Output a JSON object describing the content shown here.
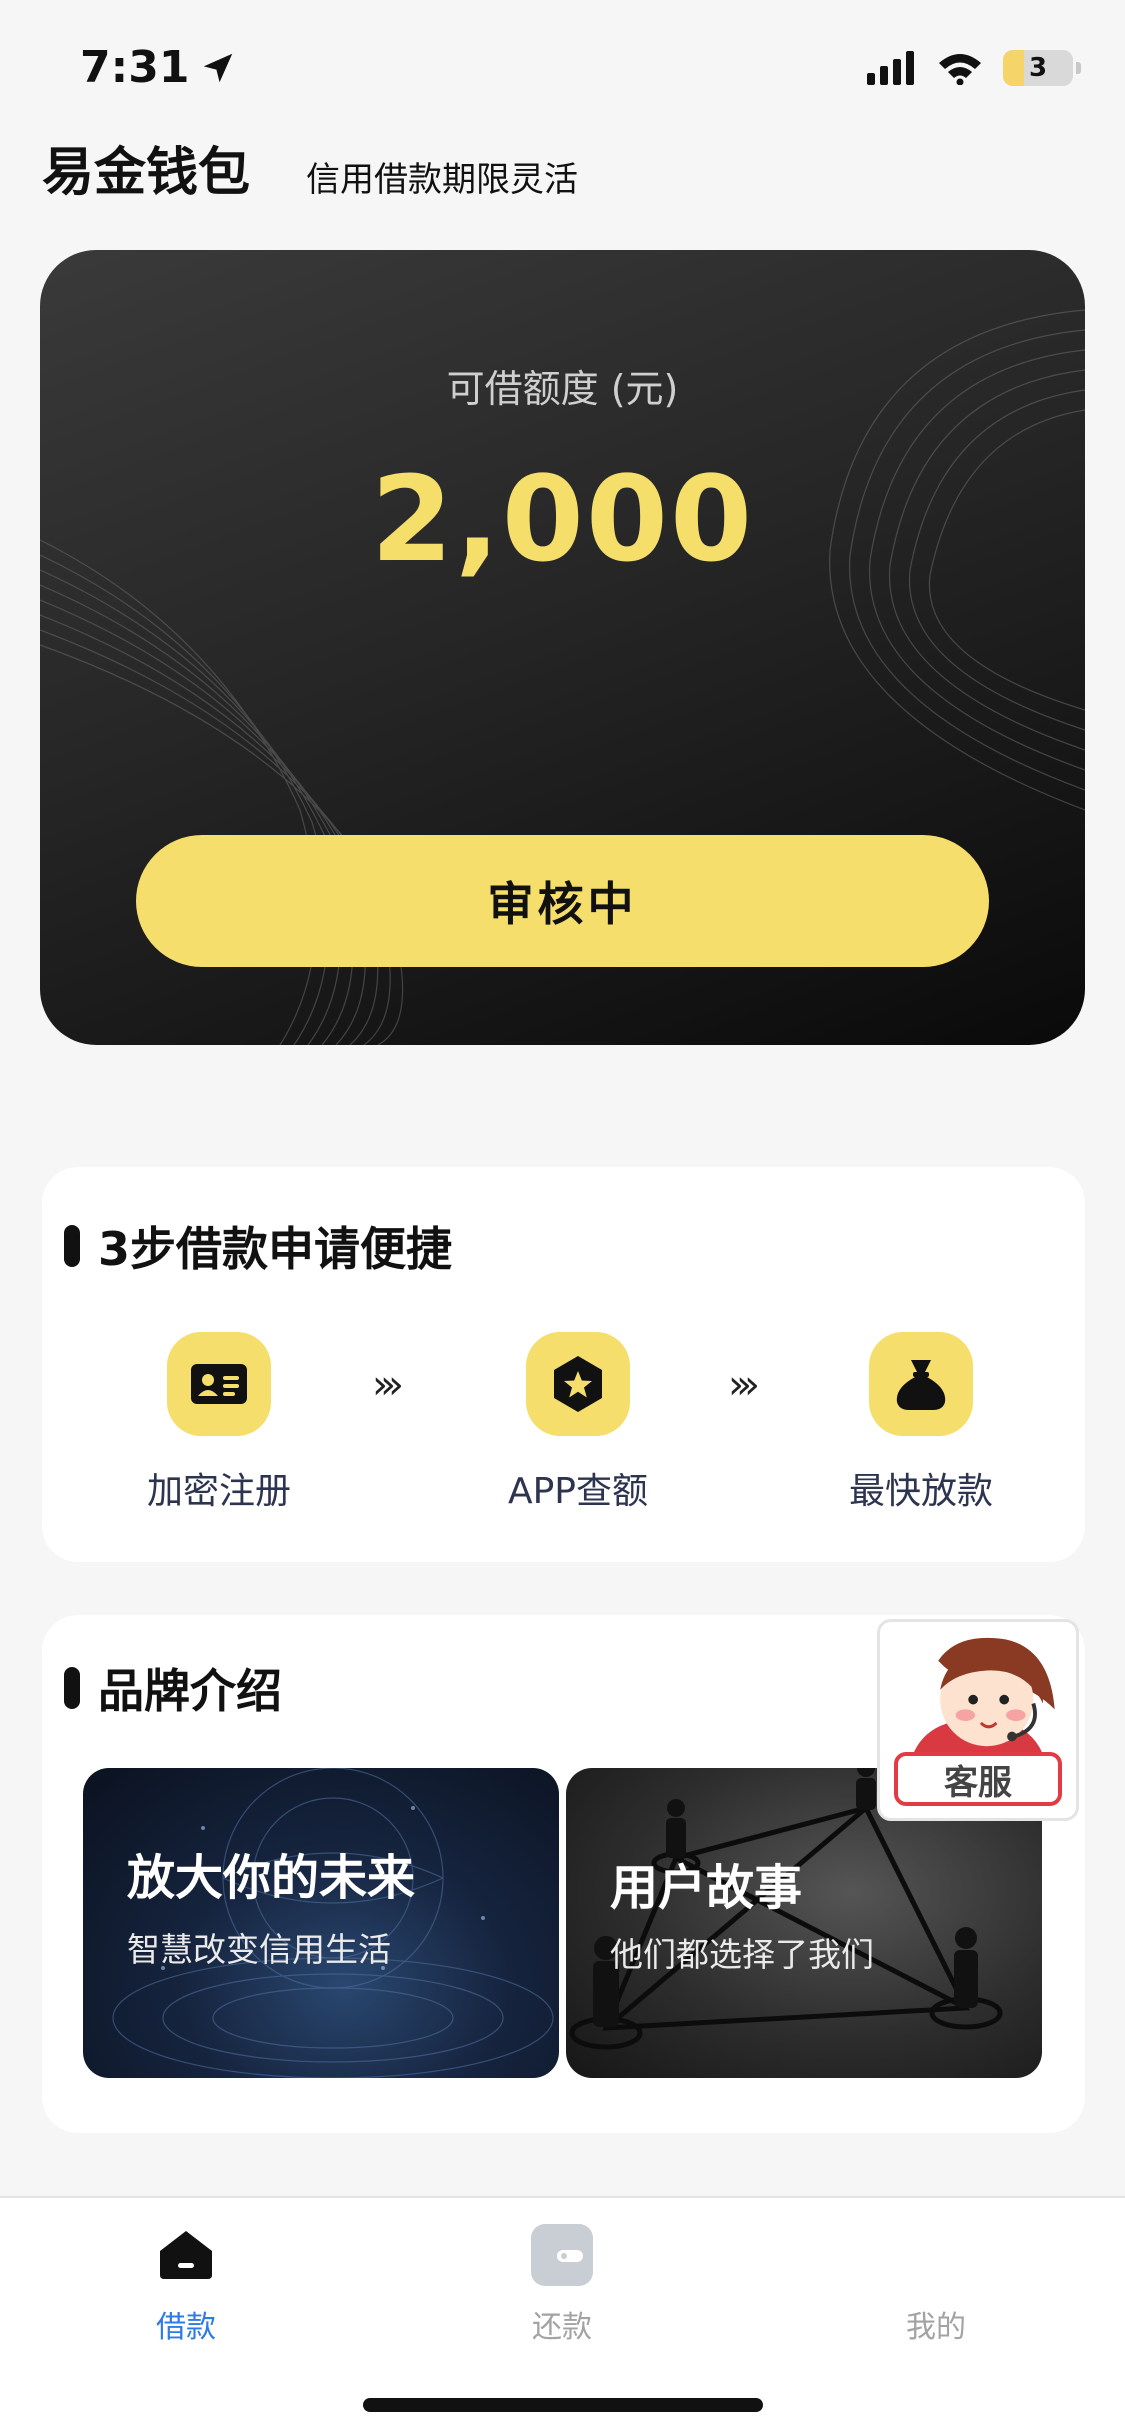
{
  "status_bar": {
    "time": "7:31",
    "battery_level": "3"
  },
  "header": {
    "app_title": "易金钱包",
    "slogan": "信用借款期限灵活"
  },
  "credit_card": {
    "label": "可借额度 (元)",
    "amount": "2,000",
    "action_label": "审核中",
    "accent_color": "#f6de6c"
  },
  "steps_section": {
    "title": "3步借款申请便捷",
    "steps": [
      {
        "label": "加密注册",
        "icon": "id-card-icon"
      },
      {
        "label": "APP查额",
        "icon": "star-badge-icon"
      },
      {
        "label": "最快放款",
        "icon": "money-bag-icon"
      }
    ],
    "arrow_glyph": "›››"
  },
  "brand_section": {
    "title": "品牌介绍",
    "tiles": [
      {
        "title": "放大你的未来",
        "subtitle": "智慧改变信用生活"
      },
      {
        "title": "用户故事",
        "subtitle": "他们都选择了我们"
      }
    ]
  },
  "customer_service": {
    "label": "客服"
  },
  "tab_bar": {
    "active_color": "#2f7be5",
    "inactive_color": "#a3a3a3",
    "tabs": [
      {
        "label": "借款",
        "icon": "home-icon",
        "active": true
      },
      {
        "label": "还款",
        "icon": "wallet-icon",
        "active": false
      },
      {
        "label": "我的",
        "icon": "profile-icon",
        "active": false
      }
    ]
  }
}
